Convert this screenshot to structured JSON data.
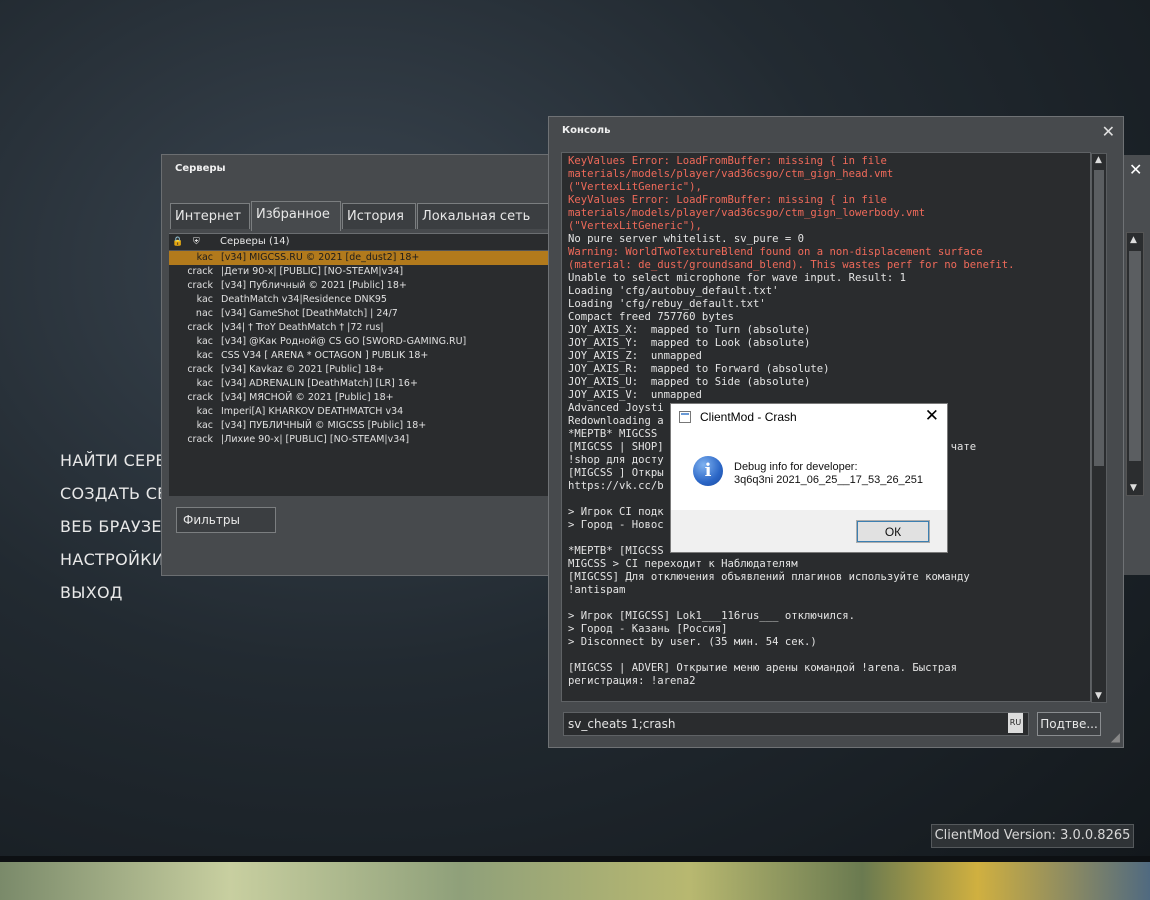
{
  "main_menu": {
    "items": [
      "НАЙТИ СЕРВЕРЫ",
      "СОЗДАТЬ СЕРВЕР",
      "ВЕБ БРАУЗЕР",
      "НАСТРОЙКИ",
      "ВЫХОД"
    ]
  },
  "version": "ClientMod Version: 3.0.0.8265",
  "servers": {
    "title": "Серверы",
    "tabs": [
      "Интернет",
      "Избранное",
      "История",
      "Локальная сеть"
    ],
    "active_tab": "Избранное",
    "header": "Серверы (14)",
    "rows": [
      {
        "ac": "kac",
        "name": "[v34] MIGCSS.RU © 2021 [de_dust2] 18+",
        "selected": true
      },
      {
        "ac": "crack",
        "name": "|Дети 90-х| [PUBLIC] [NO-STEAM|v34]"
      },
      {
        "ac": "crack",
        "name": "[v34] Публичный © 2021 [Public] 18+"
      },
      {
        "ac": "kac",
        "name": "DeathMatch v34|Residence DNK95"
      },
      {
        "ac": "nac",
        "name": "[v34] GameShot [DeathMatch] | 24/7"
      },
      {
        "ac": "crack",
        "name": "|v34| † TroY DeathMatch † |72 rus|"
      },
      {
        "ac": "kac",
        "name": "[v34] @Как Родной@ CS GO [SWORD-GAMING.RU]"
      },
      {
        "ac": "kac",
        "name": "CSS V34 [ ARENA * OCTAGON ] PUBLIK 18+"
      },
      {
        "ac": "crack",
        "name": "[v34] Kavkaz © 2021 [Public] 18+"
      },
      {
        "ac": "kac",
        "name": "[v34] ADRENALIN [DeathMatch] [LR] 16+"
      },
      {
        "ac": "crack",
        "name": "[v34] МЯСНОЙ © 2021 [Public] 18+"
      },
      {
        "ac": "kac",
        "name": "Imperi[A] KHARKOV DEATHMATCH v34"
      },
      {
        "ac": "kac",
        "name": "[v34] ПУБЛИЧНЫЙ © MIGCSS [Public] 18+"
      },
      {
        "ac": "crack",
        "name": "|Лихие 90-х| [PUBLIC] [NO-STEAM|v34]"
      }
    ],
    "filters_label": "Фильтры"
  },
  "console": {
    "title": "Консоль",
    "lines": [
      {
        "t": "KeyValues Error: LoadFromBuffer: missing { in file",
        "red": true
      },
      {
        "t": "materials/models/player/vad36csgo/ctm_gign_head.vmt",
        "red": true
      },
      {
        "t": "(\"VertexLitGeneric\"),",
        "red": true
      },
      {
        "t": "KeyValues Error: LoadFromBuffer: missing { in file",
        "red": true
      },
      {
        "t": "materials/models/player/vad36csgo/ctm_gign_lowerbody.vmt",
        "red": true
      },
      {
        "t": "(\"VertexLitGeneric\"),",
        "red": true
      },
      {
        "t": "No pure server whitelist. sv_pure = 0",
        "red": false
      },
      {
        "t": "Warning: WorldTwoTextureBlend found on a non-displacement surface",
        "red": true
      },
      {
        "t": "(material: de_dust/groundsand_blend). This wastes perf for no benefit.",
        "red": true
      },
      {
        "t": "Unable to select microphone for wave input. Result: 1",
        "red": false
      },
      {
        "t": "Loading 'cfg/autobuy_default.txt'",
        "red": false
      },
      {
        "t": "Loading 'cfg/rebuy_default.txt'",
        "red": false
      },
      {
        "t": "Compact freed 757760 bytes",
        "red": false
      },
      {
        "t": "JOY_AXIS_X:  mapped to Turn (absolute)",
        "red": false
      },
      {
        "t": "JOY_AXIS_Y:  mapped to Look (absolute)",
        "red": false
      },
      {
        "t": "JOY_AXIS_Z:  unmapped",
        "red": false
      },
      {
        "t": "JOY_AXIS_R:  mapped to Forward (absolute)",
        "red": false
      },
      {
        "t": "JOY_AXIS_U:  mapped to Side (absolute)",
        "red": false
      },
      {
        "t": "JOY_AXIS_V:  unmapped",
        "red": false
      },
      {
        "t": "Advanced Joysti",
        "red": false
      },
      {
        "t": "Redownloading a",
        "red": false
      },
      {
        "t": "*МЕРТВ* MIGCSS",
        "red": false
      },
      {
        "t": "[MIGCSS | SHOP]                                   введите в чате",
        "red": false
      },
      {
        "t": "!shop для досту",
        "red": false
      },
      {
        "t": "[MIGCSS ] Откры",
        "red": false
      },
      {
        "t": "https://vk.cc/b",
        "red": false
      },
      {
        "t": "",
        "red": false
      },
      {
        "t": "> Игрок CI подк",
        "red": false
      },
      {
        "t": "> Город - Новос",
        "red": false
      },
      {
        "t": "",
        "red": false
      },
      {
        "t": "*МЕРТВ* [MIGCSS",
        "red": false
      },
      {
        "t": "MIGCSS > CI переходит к Наблюдателям",
        "red": false
      },
      {
        "t": "[MIGCSS] Для отключения объявлений плагинов используйте команду",
        "red": false
      },
      {
        "t": "!antispam",
        "red": false
      },
      {
        "t": "",
        "red": false
      },
      {
        "t": "> Игрок [MIGCSS] Lok1___116rus___ отключился.",
        "red": false
      },
      {
        "t": "> Город - Казань [Россия]",
        "red": false
      },
      {
        "t": "> Disconnect by user. (35 мин. 54 сек.)",
        "red": false
      },
      {
        "t": "",
        "red": false
      },
      {
        "t": "[MIGCSS | ADVER] Открытие меню арены командой !arena. Быстрая",
        "red": false
      },
      {
        "t": "регистрация: !arena2",
        "red": false
      }
    ],
    "input_value": "sv_cheats 1;crash",
    "lang": "RU",
    "submit_label": "Подтве..."
  },
  "dialog": {
    "title": "ClientMod - Crash",
    "message_line1": "Debug info for developer:",
    "message_line2": "3q6q3ni 2021_06_25__17_53_26_251",
    "ok_label": "ОК"
  },
  "colors": {
    "selected_row": "#b27a1c",
    "console_error": "#ef6a5a",
    "info_icon": "#2b66c6"
  }
}
